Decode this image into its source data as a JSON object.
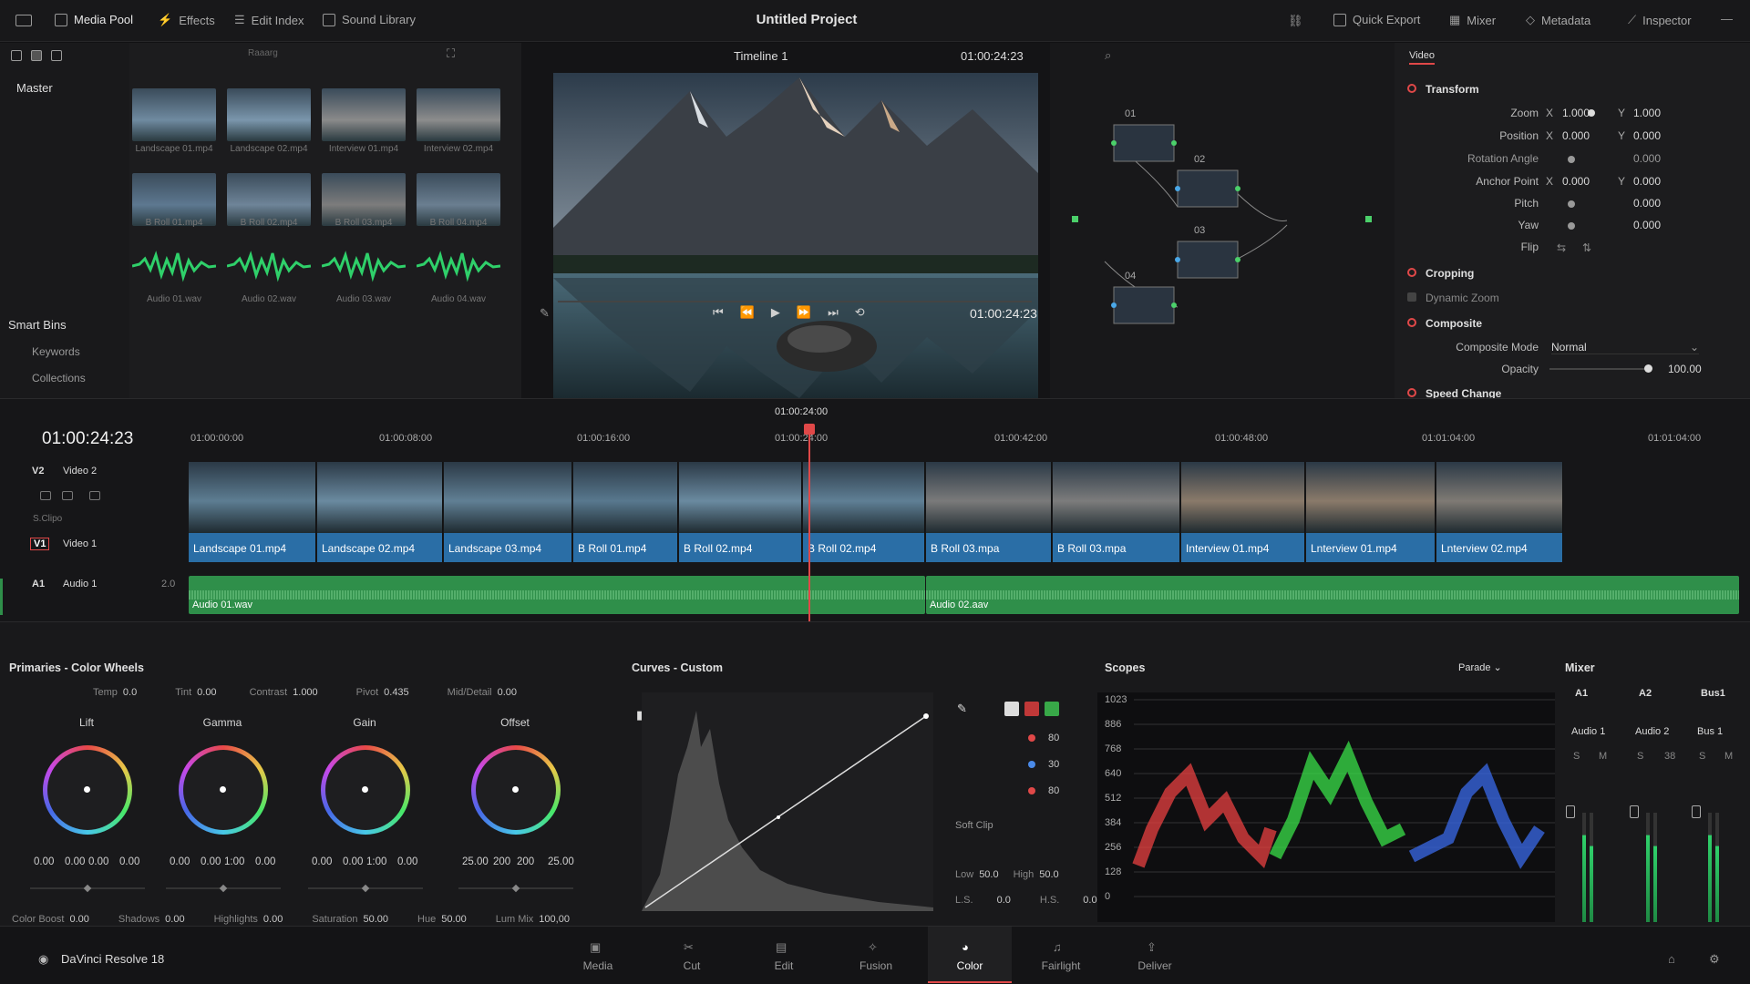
{
  "topbar": {
    "media_pool": "Media Pool",
    "effects": "Effects",
    "edit_index": "Edit Index",
    "sound_library": "Sound Library",
    "project_title": "Untitled Project",
    "quick_export": "Quick Export",
    "mixer": "Mixer",
    "metadata": "Metadata",
    "inspector": "Inspector"
  },
  "media_pool": {
    "master": "Master",
    "folder_label": "Raaarg",
    "smart_bins": "Smart Bins",
    "keywords": "Keywords",
    "collections": "Collections",
    "clips": [
      "Landscape 01.mp4",
      "Landscape 02.mp4",
      "Interview 01.mp4",
      "Interview 02.mp4",
      "B Roll 01.mp4",
      "B Roll 02.mp4",
      "B Roll 03.mp4",
      "B Roll 04.mp4"
    ],
    "audio": [
      "Audio 01.wav",
      "Audio 02.wav",
      "Audio 03.wav",
      "Audio 04.wav"
    ]
  },
  "viewer": {
    "timeline_name": "Timeline 1",
    "timecode_top": "01:00:24:23",
    "timecode_bottom": "01:00:24:23"
  },
  "nodes": {
    "labels": [
      "01",
      "02",
      "03",
      "04"
    ]
  },
  "inspector": {
    "tab": "Video",
    "transform": "Transform",
    "zoom": "Zoom",
    "zoom_x": "1.000",
    "zoom_y": "1.000",
    "position": "Position",
    "pos_x": "0.000",
    "pos_y": "0.000",
    "rotation": "Rotation Angle",
    "rotation_val": "0.000",
    "anchor": "Anchor Point",
    "anchor_x": "0.000",
    "anchor_y": "0.000",
    "pitch": "Pitch",
    "pitch_val": "0.000",
    "yaw": "Yaw",
    "yaw_val": "0.000",
    "flip": "Flip",
    "x": "X",
    "y": "Y",
    "cropping": "Cropping",
    "dynamic_zoom": "Dynamic Zoom",
    "composite": "Composite",
    "composite_mode": "Composite Mode",
    "composite_mode_val": "Normal",
    "opacity": "Opacity",
    "opacity_val": "100.00",
    "speed_change": "Speed Change"
  },
  "timeline": {
    "timecode": "01:00:24:23",
    "playhead_tc": "01:00:24:00",
    "ruler": [
      "01:00:00:00",
      "01:00:08:00",
      "01:00:16:00",
      "01:00:24:00",
      "01:00:42:00",
      "01:00:48:00",
      "01:01:04:00",
      "01:01:04:00"
    ],
    "tracks": {
      "v2": "V2",
      "v2_name": "Video 2",
      "sclip": "S.Clipo",
      "v1": "V1",
      "v1_name": "Video 1",
      "a1": "A1",
      "a1_name": "Audio 1",
      "a1_level": "2.0"
    },
    "clips": [
      "Landscape 01.mp4",
      "Landscape 02.mp4",
      "Landscape 03.mp4",
      "B Roll 01.mp4",
      "B Roll 02.mp4",
      "B Roll 02.mp4",
      "B Roll 03.mpa",
      "B Roll 03.mpa",
      "Interview 01.mp4",
      "Lnterview 01.mp4",
      "Lnterview 02.mp4"
    ],
    "audio_clips": [
      "Audio 01.wav",
      "Audio 02.aav"
    ]
  },
  "color": {
    "primaries_title": "Primaries - Color Wheels",
    "temp": "Temp",
    "temp_val": "0.0",
    "tint": "Tint",
    "tint_val": "0.00",
    "contrast": "Contrast",
    "contrast_val": "1.000",
    "pivot": "Pivot",
    "pivot_val": "0.435",
    "mid_detail": "Mid/Detail",
    "mid_detail_val": "0.00",
    "wheels": [
      {
        "name": "Lift",
        "vals": [
          "0.00",
          "0.00",
          "0.00",
          "0.00"
        ]
      },
      {
        "name": "Gamma",
        "vals": [
          "0.00",
          "0.00",
          "1:00",
          "0.00"
        ]
      },
      {
        "name": "Gain",
        "vals": [
          "0.00",
          "0.00",
          "1:00",
          "0.00"
        ]
      },
      {
        "name": "Offset",
        "vals": [
          "25.00",
          "200",
          "200",
          "25.00"
        ]
      }
    ],
    "color_boost": "Color Boost",
    "color_boost_val": "0.00",
    "shadows": "Shadows",
    "shadows_val": "0.00",
    "highlights": "Highlights",
    "highlights_val": "0.00",
    "saturation": "Saturation",
    "saturation_val": "50.00",
    "hue": "Hue",
    "hue_val": "50.00",
    "lum_mix": "Lum Mix",
    "lum_mix_val": "100,00"
  },
  "curves": {
    "title": "Curves - Custom",
    "r_val": "80",
    "g_val": "30",
    "b_val": "80",
    "soft_clip": "Soft Clip",
    "low": "Low",
    "low_val": "50.0",
    "high": "High",
    "high_val": "50.0",
    "ls": "L.S.",
    "ls_val": "0.0",
    "hs": "H.S.",
    "hs_val": "0.0"
  },
  "scopes": {
    "title": "Scopes",
    "mode": "Parade",
    "scale": [
      "1023",
      "886",
      "768",
      "640",
      "512",
      "384",
      "256",
      "128",
      "0"
    ]
  },
  "mixer": {
    "title": "Mixer",
    "channels": [
      "A1",
      "A2",
      "Bus1"
    ],
    "names": [
      "Audio 1",
      "Audio 2",
      "Bus 1"
    ],
    "s": "S",
    "m": "M",
    "a2_db": "38"
  },
  "bottom": {
    "app": "DaVinci Resolve 18",
    "pages": [
      "Media",
      "Cut",
      "Edit",
      "Fusion",
      "Color",
      "Fairlight",
      "Deliver"
    ]
  },
  "colors": {
    "accent": "#e04848",
    "clip_blue": "#2a6ea6",
    "audio_green": "#2f8f4a"
  }
}
